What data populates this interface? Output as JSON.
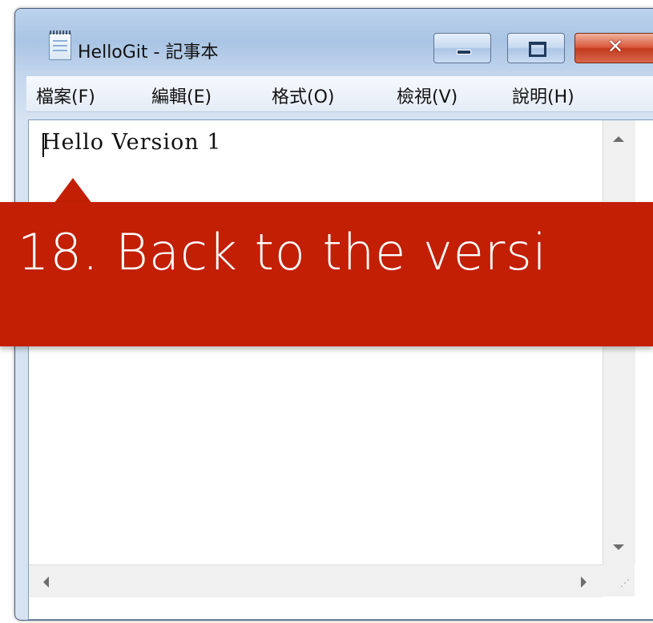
{
  "window": {
    "title": "HelloGit - 記事本",
    "close_glyph": "✕",
    "icon": "notepad-icon"
  },
  "menu": {
    "items": [
      "檔案(F)",
      "編輯(E)",
      "格式(O)",
      "檢視(V)",
      "說明(H)"
    ]
  },
  "editor": {
    "content": "Hello Version 1"
  },
  "callout": {
    "text": "18. Back to the versi",
    "color": "#c21f04"
  },
  "scrollbar": {
    "grip": "⋰"
  }
}
